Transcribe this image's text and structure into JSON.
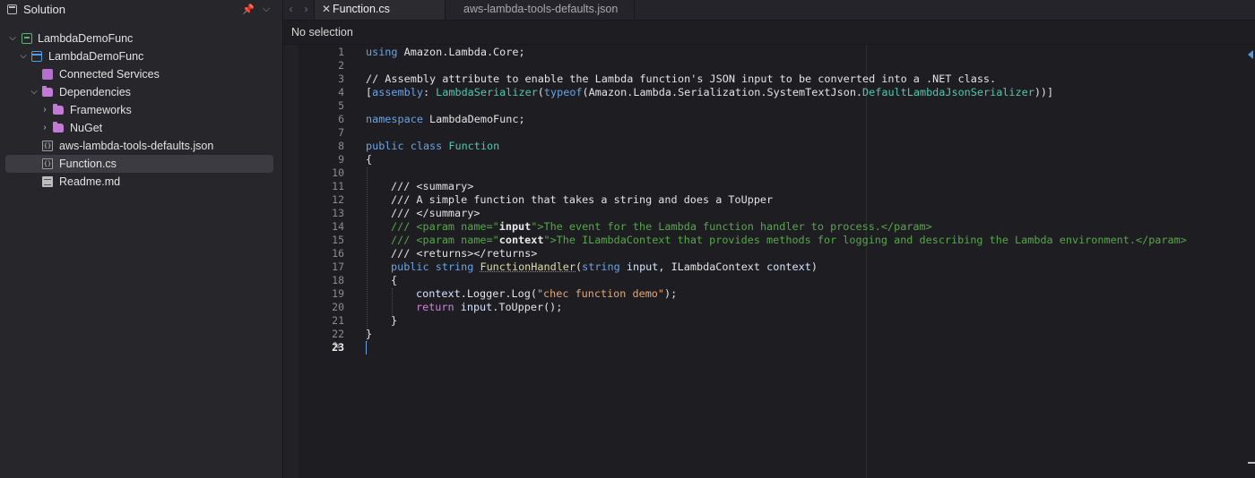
{
  "sidebar": {
    "title": "Solution",
    "pin_icon": "pin-icon",
    "menu_icon": "chevron-down-icon",
    "tree": [
      {
        "label": "LambdaDemoFunc",
        "icon": "solution-icon",
        "expanded": true,
        "depth": 0
      },
      {
        "label": "LambdaDemoFunc",
        "icon": "project-icon",
        "expanded": true,
        "depth": 1
      },
      {
        "label": "Connected Services",
        "icon": "connected-services-icon",
        "depth": 2
      },
      {
        "label": "Dependencies",
        "icon": "folder-icon",
        "expanded": true,
        "depth": 2
      },
      {
        "label": "Frameworks",
        "icon": "folder-icon",
        "expanded": false,
        "depth": 3
      },
      {
        "label": "NuGet",
        "icon": "folder-icon",
        "expanded": false,
        "depth": 3
      },
      {
        "label": "aws-lambda-tools-defaults.json",
        "icon": "json-file-icon",
        "depth": 2
      },
      {
        "label": "Function.cs",
        "icon": "cs-file-icon",
        "depth": 2,
        "selected": true
      },
      {
        "label": "Readme.md",
        "icon": "markdown-file-icon",
        "depth": 2
      }
    ]
  },
  "tabs": [
    {
      "label": "Function.cs",
      "active": true
    },
    {
      "label": "aws-lambda-tools-defaults.json",
      "active": false
    }
  ],
  "breadcrumb": "No selection",
  "editor": {
    "current_line": 23,
    "line_numbers": [
      "1",
      "2",
      "3",
      "4",
      "5",
      "6",
      "7",
      "8",
      "9",
      "10",
      "11",
      "12",
      "13",
      "14",
      "15",
      "16",
      "17",
      "18",
      "19",
      "20",
      "21",
      "22",
      "23"
    ],
    "code": {
      "l1a": "using",
      "l1b": " Amazon.Lambda.Core;",
      "l3": "// Assembly attribute to enable the Lambda function's JSON input to be converted into a .NET class.",
      "l4a": "[",
      "l4b": "assembly",
      "l4c": ": ",
      "l4d": "LambdaSerializer",
      "l4e": "(",
      "l4f": "typeof",
      "l4g": "(Amazon.Lambda.Serialization.SystemTextJson.",
      "l4h": "DefaultLambdaJsonSerializer",
      "l4i": "))]",
      "l6a": "namespace",
      "l6b": " LambdaDemoFunc;",
      "l8a": "public",
      "l8b": " ",
      "l8c": "class",
      "l8d": " ",
      "l8e": "Function",
      "l9": "{",
      "l11": "/// <summary>",
      "l12": "/// A simple function that takes a string and does a ToUpper",
      "l13": "/// </summary>",
      "l14a": "/// <param name=\"",
      "l14b": "input",
      "l14c": "\">The event for the Lambda function handler to process.</param>",
      "l15a": "/// <param name=\"",
      "l15b": "context",
      "l15c": "\">The ILambdaContext that provides methods for logging and describing the Lambda environment.</param>",
      "l16": "/// <returns></returns>",
      "l17a": "public",
      "l17b": " ",
      "l17c": "string",
      "l17d": " ",
      "l17e": "FunctionHandler",
      "l17f": "(",
      "l17g": "string",
      "l17h": " ",
      "l17i": "input",
      "l17j": ", ILambdaContext ",
      "l17k": "context",
      "l17l": ")",
      "l18": "{",
      "l19a": "context",
      "l19b": ".Logger.Log(",
      "l19c": "\"chec function demo\"",
      "l19d": ");",
      "l20a": "return",
      "l20b": " ",
      "l20c": "input",
      "l20d": ".ToUpper();",
      "l21": "}",
      "l22": "}"
    }
  },
  "colors": {
    "keyword": "#6aa3e6",
    "control_keyword": "#c985d8",
    "comment": "#57a64a",
    "type": "#4ec9b0",
    "method": "#dcdcaa",
    "string": "#e2a77b",
    "background": "#1e1e22"
  }
}
